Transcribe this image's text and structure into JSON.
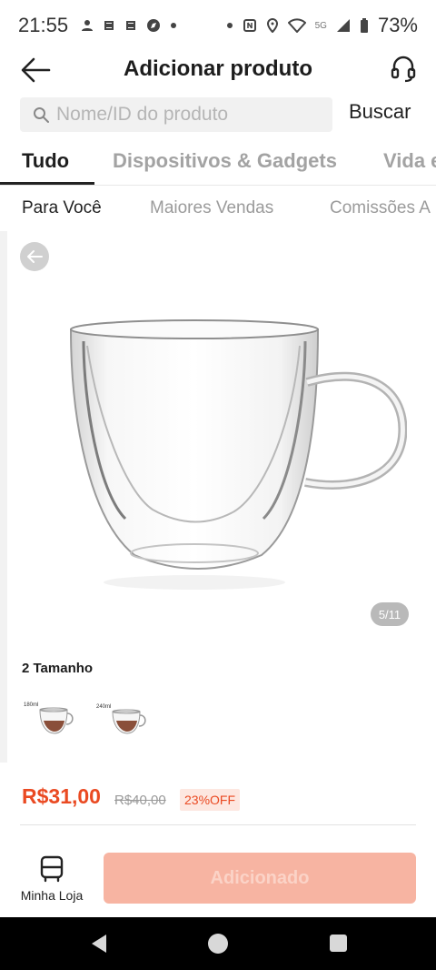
{
  "status_bar": {
    "time": "21:55",
    "network": "5G",
    "battery": "73%"
  },
  "header": {
    "title": "Adicionar produto"
  },
  "search": {
    "placeholder": "Nome/ID do produto",
    "button_label": "Buscar"
  },
  "category_tabs": [
    {
      "label": "Tudo",
      "active": true
    },
    {
      "label": "Dispositivos & Gadgets",
      "active": false
    },
    {
      "label": "Vida e",
      "active": false
    }
  ],
  "sort_tabs": [
    {
      "label": "Para Você",
      "active": true
    },
    {
      "label": "Maiores Vendas",
      "active": false
    },
    {
      "label": "Comissões A",
      "active": false
    }
  ],
  "product": {
    "gallery_page": "5/11",
    "variant_title": "2 Tamanho",
    "variants": [
      {
        "size_label": "180ml"
      },
      {
        "size_label": "240ml"
      }
    ],
    "price": "R$31,00",
    "original_price": "R$40,00",
    "discount": "23%OFF"
  },
  "action_bar": {
    "store_label": "Minha Loja",
    "add_button_label": "Adicionado"
  },
  "colors": {
    "accent": "#ea4a22",
    "add_button_bg": "#f7b4a2"
  }
}
